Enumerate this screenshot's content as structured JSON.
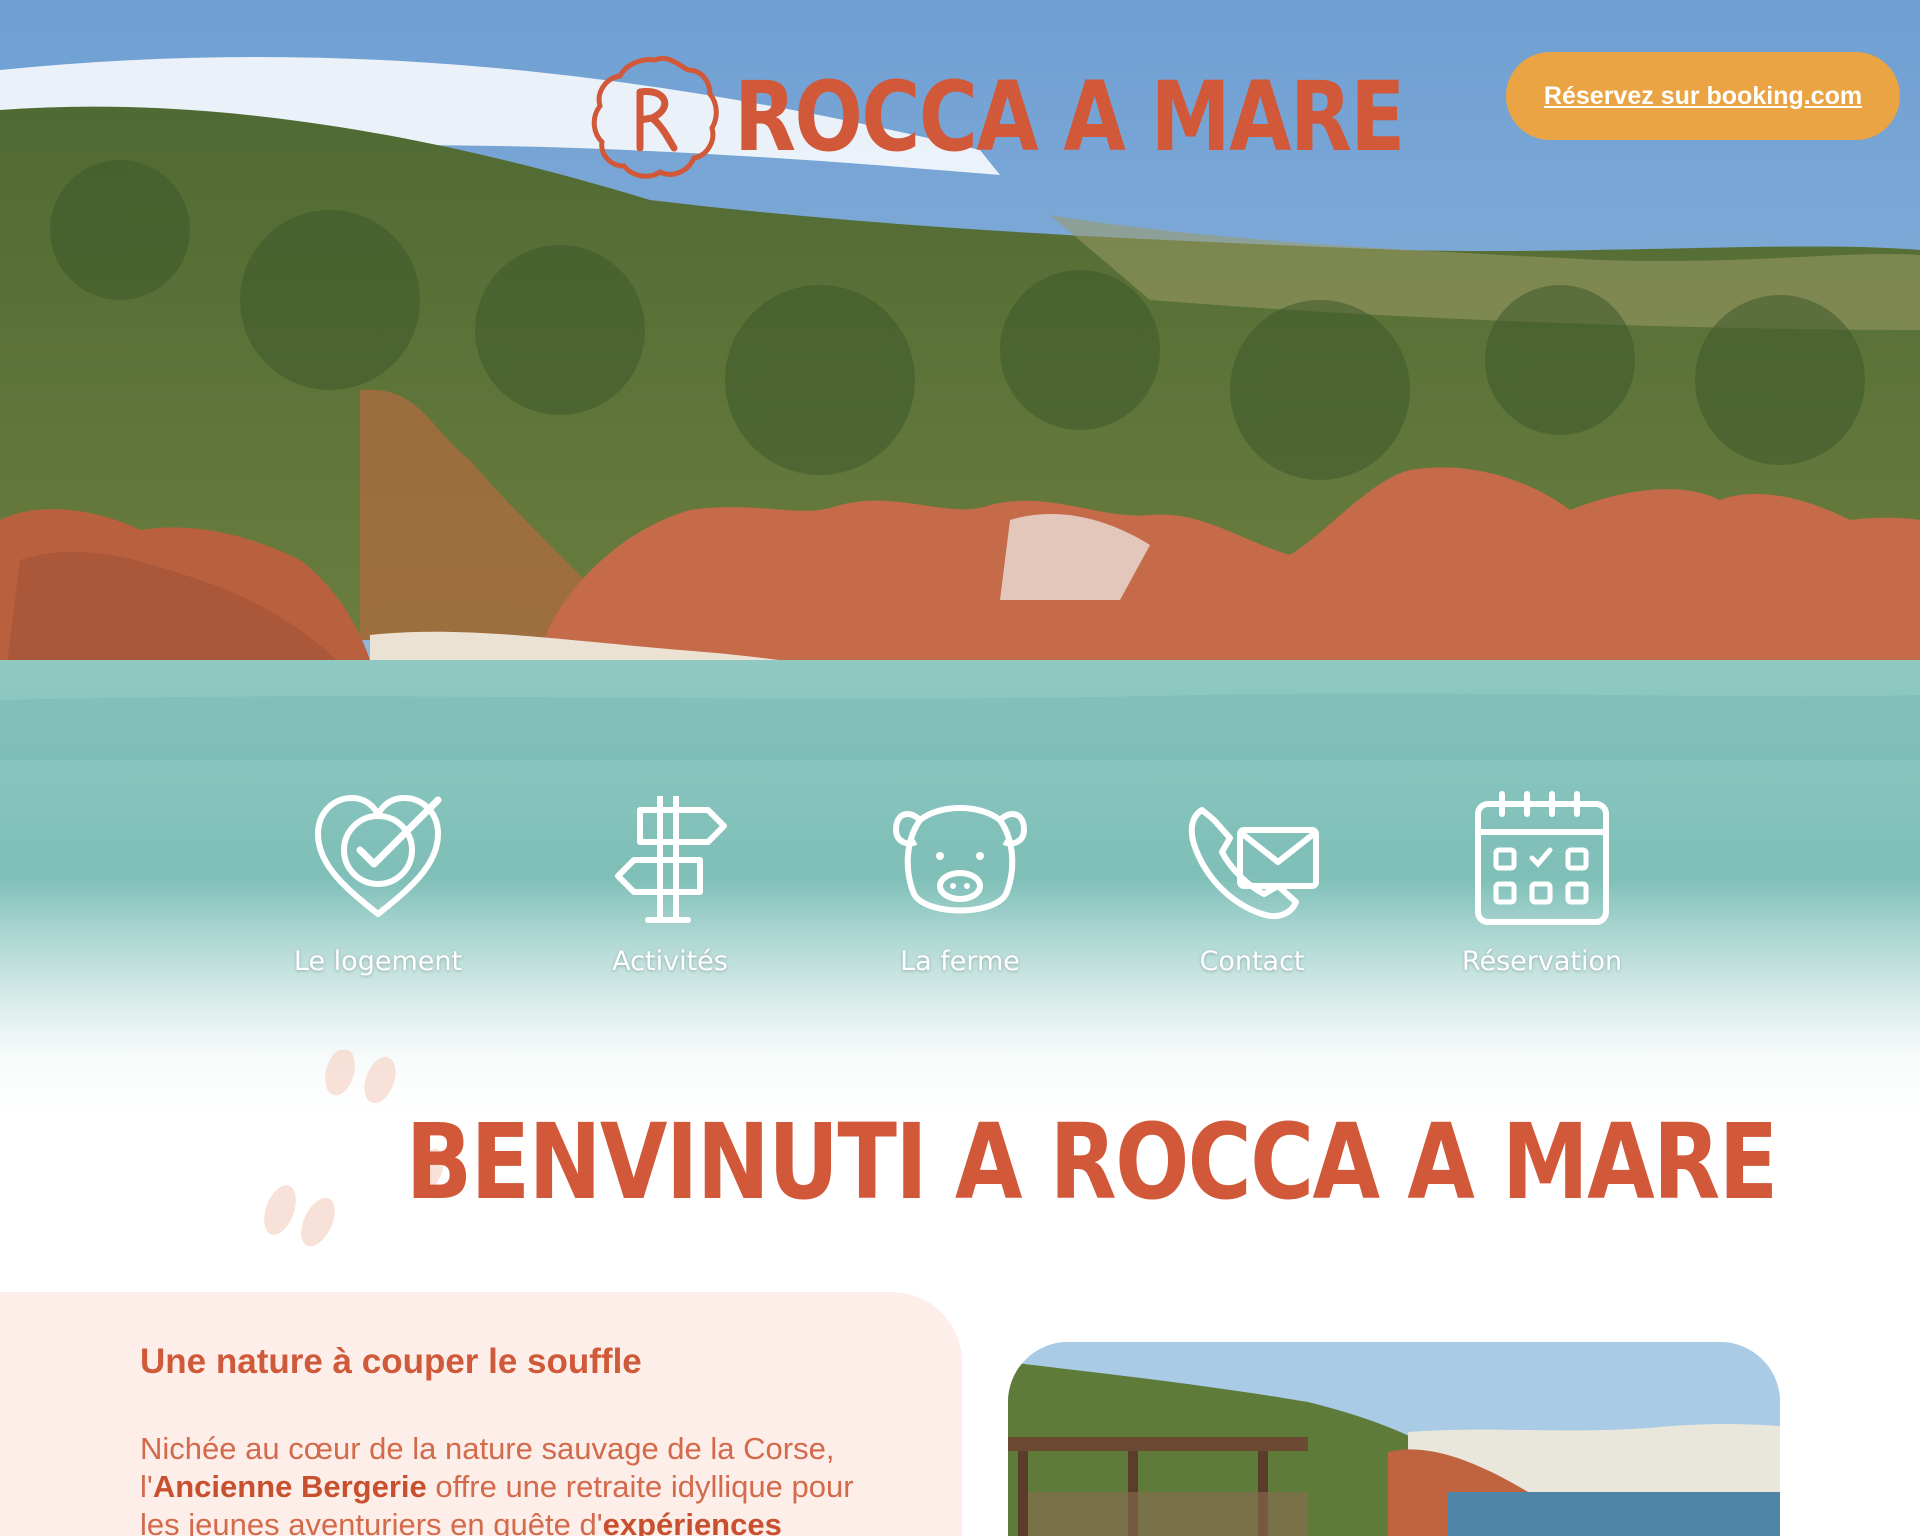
{
  "header": {
    "brand": "ROCCA A MARE",
    "booking_button": "Réservez sur booking.com"
  },
  "nav": {
    "items": [
      {
        "label": "Le logement",
        "icon": "heart-check-icon"
      },
      {
        "label": "Activités",
        "icon": "signpost-icon"
      },
      {
        "label": "La ferme",
        "icon": "pig-icon"
      },
      {
        "label": "Contact",
        "icon": "phone-mail-icon"
      },
      {
        "label": "Réservation",
        "icon": "calendar-icon"
      }
    ]
  },
  "welcome": {
    "title": "BENVINUTI A ROCCA A MARE"
  },
  "intro": {
    "heading": "Une nature à couper le souffle",
    "text_1": "Nichée au cœur de la nature sauvage de la Corse,",
    "text_2": "l'",
    "bold_1": "Ancienne Bergerie",
    "text_3": " offre une retraite idyllique pour",
    "text_4": "les jeunes aventuriers en quête d'",
    "bold_2": "expériences"
  },
  "colors": {
    "brand": "#d2583a",
    "booking_button": "#eaa443",
    "card_background": "#fdeee9"
  }
}
